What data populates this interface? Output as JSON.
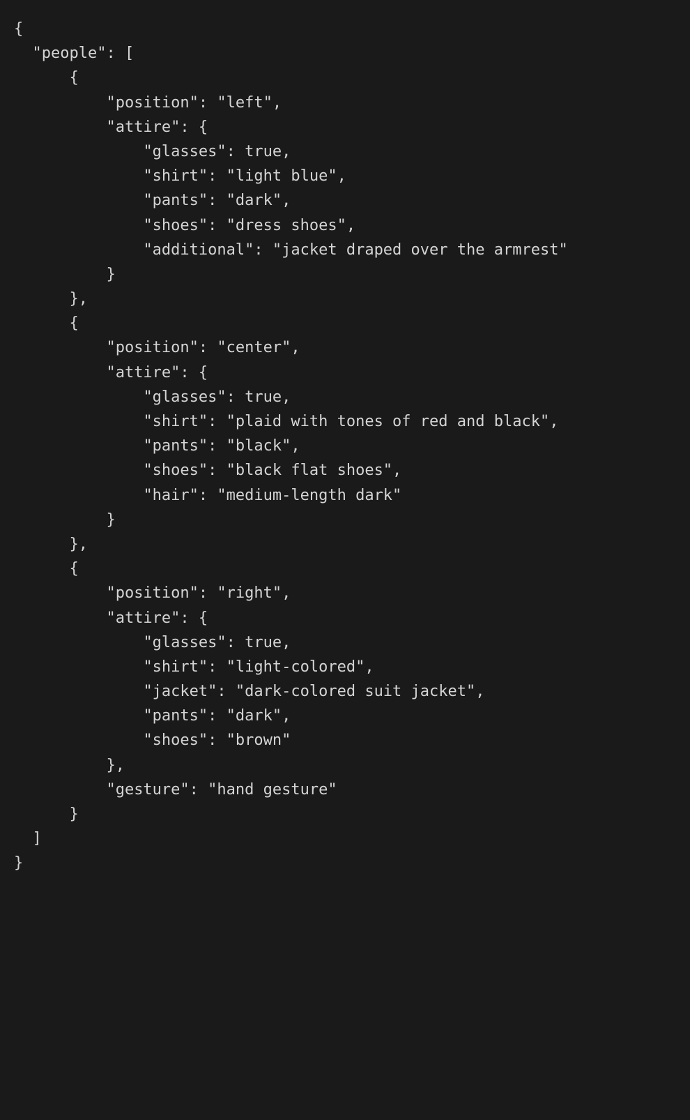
{
  "content": {
    "lines": [
      "{",
      "  \"people\": [",
      "      {",
      "          \"position\": \"left\",",
      "          \"attire\": {",
      "              \"glasses\": true,",
      "              \"shirt\": \"light blue\",",
      "              \"pants\": \"dark\",",
      "              \"shoes\": \"dress shoes\",",
      "              \"additional\": \"jacket draped over the armrest\"",
      "          }",
      "      },",
      "      {",
      "          \"position\": \"center\",",
      "          \"attire\": {",
      "              \"glasses\": true,",
      "              \"shirt\": \"plaid with tones of red and black\",",
      "              \"pants\": \"black\",",
      "              \"shoes\": \"black flat shoes\",",
      "              \"hair\": \"medium-length dark\"",
      "          }",
      "      },",
      "      {",
      "          \"position\": \"right\",",
      "          \"attire\": {",
      "              \"glasses\": true,",
      "              \"shirt\": \"light-colored\",",
      "              \"jacket\": \"dark-colored suit jacket\",",
      "              \"pants\": \"dark\",",
      "              \"shoes\": \"brown\"",
      "          },",
      "          \"gesture\": \"hand gesture\"",
      "      }",
      "  ]",
      "}"
    ]
  }
}
